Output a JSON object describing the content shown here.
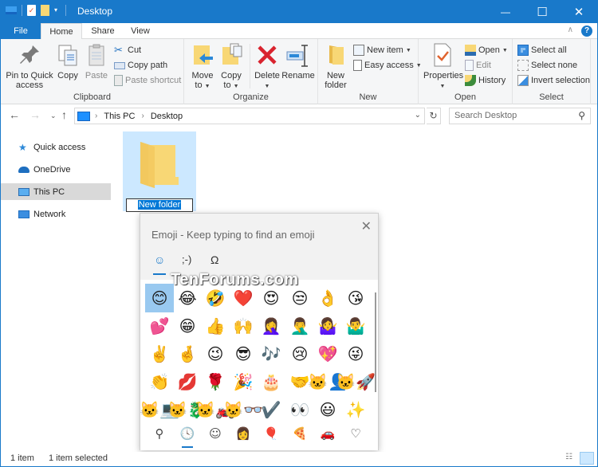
{
  "window": {
    "title": "Desktop",
    "controls": {
      "minimize": "—",
      "maximize": "☐",
      "close": "✕"
    }
  },
  "tabs": [
    {
      "label": "File"
    },
    {
      "label": "Home"
    },
    {
      "label": "Share"
    },
    {
      "label": "View"
    }
  ],
  "ribbon": {
    "clipboard": {
      "label": "Clipboard",
      "pin": "Pin to Quick access",
      "pin_l1": "Pin to Quick",
      "pin_l2": "access",
      "copy": "Copy",
      "paste": "Paste",
      "cut": "Cut",
      "copy_path": "Copy path",
      "paste_shortcut": "Paste shortcut"
    },
    "organize": {
      "label": "Organize",
      "move_l1": "Move",
      "move_l2": "to",
      "copy_l1": "Copy",
      "copy_l2": "to",
      "delete": "Delete",
      "rename": "Rename"
    },
    "new": {
      "label": "New",
      "new_folder_l1": "New",
      "new_folder_l2": "folder",
      "new_item": "New item",
      "easy_access": "Easy access"
    },
    "open": {
      "label": "Open",
      "properties": "Properties",
      "open": "Open",
      "edit": "Edit",
      "history": "History"
    },
    "select": {
      "label": "Select",
      "select_all": "Select all",
      "select_none": "Select none",
      "invert": "Invert selection"
    }
  },
  "address": {
    "crumbs": [
      "This PC",
      "Desktop"
    ],
    "search_placeholder": "Search Desktop"
  },
  "navpane": {
    "items": [
      {
        "label": "Quick access",
        "icon": "star-icon"
      },
      {
        "label": "OneDrive",
        "icon": "cloud-icon"
      },
      {
        "label": "This PC",
        "icon": "computer-icon",
        "selected": true
      },
      {
        "label": "Network",
        "icon": "network-icon"
      }
    ]
  },
  "content": {
    "folder_name": "New folder"
  },
  "emoji_panel": {
    "title": "Emoji - Keep typing to find an emoji",
    "tabs": [
      "☺",
      ";-)",
      "Ω"
    ],
    "watermark": "TenForums.com",
    "grid": [
      [
        "😊",
        "😂",
        "🤣",
        "❤️",
        "😍",
        "😒",
        "👌",
        "😘"
      ],
      [
        "💕",
        "😁",
        "👍",
        "🙌",
        "🤦‍♀️",
        "🤦‍♂️",
        "🤷‍♀️",
        "🤷‍♂️"
      ],
      [
        "✌️",
        "🤞",
        "😉",
        "😎",
        "🎶",
        "😢",
        "💖",
        "😜"
      ],
      [
        "👏",
        "💋",
        "🌹",
        "🎉",
        "🎂",
        "🤝",
        "🐱‍👤",
        "🐱‍🚀"
      ],
      [
        "🐱‍💻",
        "🐱‍🐉",
        "🐱‍🏍",
        "🐱‍👓",
        "✔️",
        "👀",
        "😃",
        "✨"
      ]
    ],
    "categories": [
      "⚲",
      "🕓",
      "☺",
      "👩",
      "🎈",
      "🍕",
      "🚗",
      "♡"
    ],
    "category_names": [
      "search",
      "recent",
      "smiley",
      "people",
      "celebration",
      "food",
      "travel",
      "symbols"
    ]
  },
  "status": {
    "count": "1 item",
    "selected": "1 item selected"
  }
}
